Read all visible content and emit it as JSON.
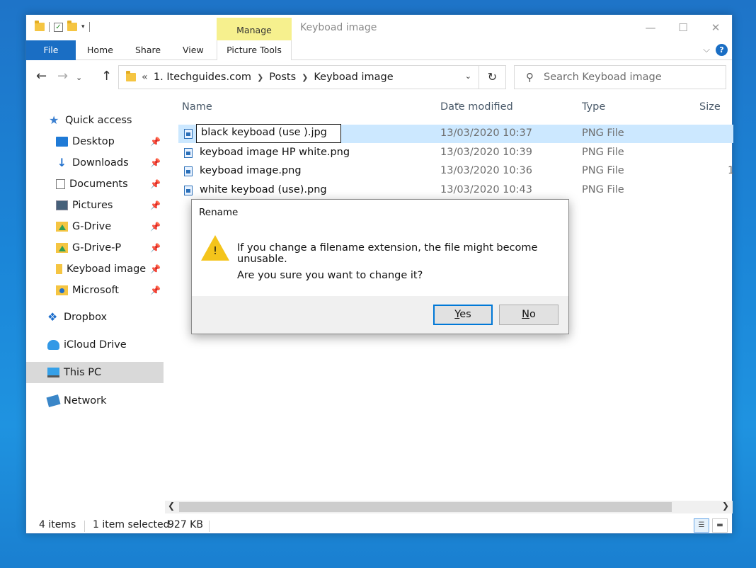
{
  "window": {
    "title": "Keyboad image",
    "contextual_tab_group": "Manage",
    "controls": {
      "minimize": "—",
      "maximize": "☐",
      "close": "✕"
    }
  },
  "ribbon": {
    "tabs": [
      "File",
      "Home",
      "Share",
      "View"
    ],
    "contextual_tab": "Picture Tools",
    "help": "?"
  },
  "address": {
    "breadcrumb_prefix": "«",
    "parts": [
      "1. Itechguides.com",
      "Posts",
      "Keyboad image"
    ],
    "search_placeholder": "Search Keyboad image"
  },
  "navpane": {
    "items": [
      {
        "label": "Quick access",
        "icon": "star-icon",
        "pinned": false
      },
      {
        "label": "Desktop",
        "icon": "desktop-icon",
        "pinned": true
      },
      {
        "label": "Downloads",
        "icon": "download-icon",
        "pinned": true
      },
      {
        "label": "Documents",
        "icon": "document-icon",
        "pinned": true
      },
      {
        "label": "Pictures",
        "icon": "pictures-icon",
        "pinned": true
      },
      {
        "label": "G-Drive",
        "icon": "gdrive-icon",
        "pinned": true
      },
      {
        "label": "G-Drive-P",
        "icon": "gdrive-icon",
        "pinned": true
      },
      {
        "label": "Keyboad image",
        "icon": "folder-icon",
        "pinned": true
      },
      {
        "label": "Microsoft",
        "icon": "user-folder-icon",
        "pinned": true
      },
      {
        "label": "Dropbox",
        "icon": "dropbox-icon",
        "pinned": false
      },
      {
        "label": "iCloud Drive",
        "icon": "cloud-icon",
        "pinned": false
      },
      {
        "label": "This PC",
        "icon": "pc-icon",
        "pinned": false,
        "selected": true
      },
      {
        "label": "Network",
        "icon": "network-icon",
        "pinned": false
      }
    ]
  },
  "columns": {
    "name": "Name",
    "date": "Date modified",
    "type": "Type",
    "size": "Size"
  },
  "files": [
    {
      "name": "black keyboad (use ).jpg",
      "date": "13/03/2020 10:37",
      "type": "PNG File",
      "size": "",
      "selected": true,
      "renaming": true
    },
    {
      "name": "keyboad image HP white.png",
      "date": "13/03/2020 10:39",
      "type": "PNG File",
      "size": ""
    },
    {
      "name": "keyboad image.png",
      "date": "13/03/2020 10:36",
      "type": "PNG File",
      "size": "1"
    },
    {
      "name": "white keyboad (use).png",
      "date": "13/03/2020 10:43",
      "type": "PNG File",
      "size": ""
    }
  ],
  "status": {
    "items": "4 items",
    "selected": "1 item selected",
    "size": "927 KB"
  },
  "dialog": {
    "title": "Rename",
    "message1": "If you change a filename extension, the file might become unusable.",
    "message2": "Are you sure you want to change it?",
    "yes_accel": "Y",
    "yes_rest": "es",
    "no_accel": "N",
    "no_rest": "o"
  }
}
